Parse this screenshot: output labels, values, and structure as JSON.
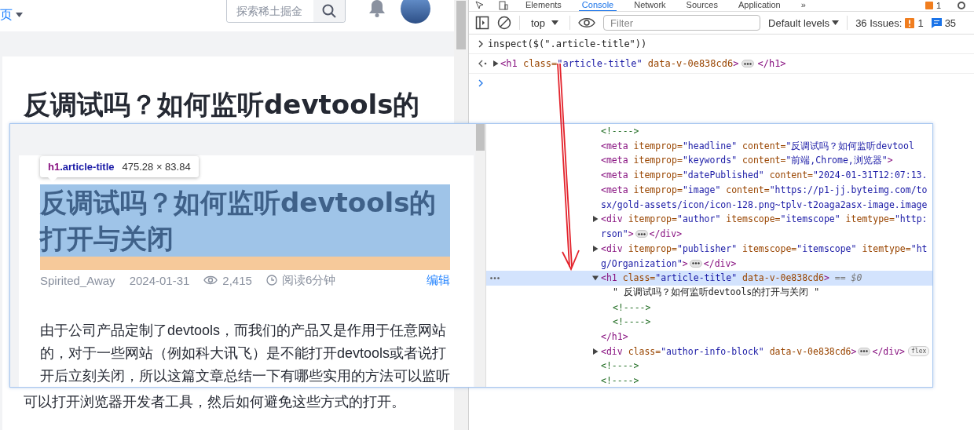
{
  "page": {
    "nav": {
      "menu_label": "页",
      "search": {
        "placeholder": "探索稀土掘金"
      }
    },
    "article": {
      "title": "反调试吗？如何监听devtools的",
      "paragraph_tail": "可以打开浏览器开发者工具，然后如何避免这些方式的打开。"
    }
  },
  "devtools": {
    "tabs": [
      {
        "label": "Elements",
        "selected": false
      },
      {
        "label": "Console",
        "selected": true
      },
      {
        "label": "Network",
        "selected": false
      },
      {
        "label": "Sources",
        "selected": false
      },
      {
        "label": "Application",
        "selected": false
      }
    ],
    "more_tabs": "»",
    "issues_badge": "1",
    "toolbar": {
      "context": "top",
      "filter_placeholder": "Filter",
      "levels": "Default levels",
      "issues_label": "36 Issues:",
      "warning_count": "1",
      "info_count": "35"
    },
    "console": [
      {
        "kind": "input",
        "text": "inspect($(\".article-title\"))"
      },
      {
        "kind": "result",
        "expanded": false,
        "segments": [
          {
            "kind": "tag",
            "text": "<h1"
          },
          {
            "kind": "attr",
            "text": " class="
          },
          {
            "kind": "value",
            "text": "\"article-title\""
          },
          {
            "kind": "attr",
            "text": " data-v-0e838cd6"
          },
          {
            "kind": "tag",
            "text": ">"
          },
          {
            "kind": "ellipsis"
          },
          {
            "kind": "tag",
            "text": "</h1>"
          }
        ]
      },
      {
        "kind": "prompt"
      }
    ]
  },
  "zoom_overlay": {
    "preview": {
      "tooltip": {
        "tag": "h1",
        "selector": ".article-title",
        "size": "475.28 × 83.84"
      },
      "title": "反调试吗？如何监听devtools的打开与关闭",
      "meta": {
        "author": "Spirited_Away",
        "date": "2024-01-31",
        "views": "2,415",
        "read_time": "阅读6分钟",
        "edit_link": "编辑"
      },
      "paragraph": "由于公司产品定制了devtools，而我们的产品又是作用于任意网站的，对于一些网站（例如科大讯飞）是不能打开devtools或者说打开后立刻关闭，所以这篇文章总结一下有哪些实用的方法可以监听"
    },
    "elements_tree": [
      {
        "kind": "comment",
        "text": "<!---->"
      },
      {
        "kind": "element",
        "lines": [
          [
            {
              "kind": "tag",
              "text": "<meta"
            },
            {
              "kind": "attr",
              "text": " itemprop="
            },
            {
              "kind": "value",
              "text": "\"headline\""
            },
            {
              "kind": "attr",
              "text": " content="
            },
            {
              "kind": "value",
              "text": "\"反调试吗？如何监听devtool"
            }
          ]
        ]
      },
      {
        "kind": "element",
        "lines": [
          [
            {
              "kind": "tag",
              "text": "<meta"
            },
            {
              "kind": "attr",
              "text": " itemprop="
            },
            {
              "kind": "value",
              "text": "\"keywords\""
            },
            {
              "kind": "attr",
              "text": " content="
            },
            {
              "kind": "value",
              "text": "\"前端,Chrome,浏览器\""
            },
            {
              "kind": "tag",
              "text": ">"
            }
          ]
        ]
      },
      {
        "kind": "element",
        "lines": [
          [
            {
              "kind": "tag",
              "text": "<meta"
            },
            {
              "kind": "attr",
              "text": " itemprop="
            },
            {
              "kind": "value",
              "text": "\"datePublished\""
            },
            {
              "kind": "attr",
              "text": " content="
            },
            {
              "kind": "value",
              "text": "\"2024-01-31T12:07:13."
            }
          ]
        ]
      },
      {
        "kind": "element",
        "lines": [
          [
            {
              "kind": "tag",
              "text": "<meta"
            },
            {
              "kind": "attr",
              "text": " itemprop="
            },
            {
              "kind": "value",
              "text": "\"image\""
            },
            {
              "kind": "attr",
              "text": " content="
            },
            {
              "kind": "value",
              "text": "\"https://p1-jj.byteimg.com/to"
            }
          ],
          [
            {
              "kind": "value",
              "text": "sx/gold-assets/icon/icon-128.png~tplv-t2oaga2asx-image.image"
            }
          ]
        ]
      },
      {
        "kind": "element",
        "expanded": false,
        "lines": [
          [
            {
              "kind": "tag",
              "text": "<div"
            },
            {
              "kind": "attr",
              "text": " itemprop="
            },
            {
              "kind": "value",
              "text": "\"author\""
            },
            {
              "kind": "attr",
              "text": " itemscope="
            },
            {
              "kind": "value",
              "text": "\"itemscope\""
            },
            {
              "kind": "attr",
              "text": " itemtype="
            },
            {
              "kind": "value",
              "text": "\"http:"
            }
          ],
          [
            {
              "kind": "value",
              "text": "rson\""
            },
            {
              "kind": "tag",
              "text": ">"
            },
            {
              "kind": "ellipsis"
            },
            {
              "kind": "tag",
              "text": "</div>"
            }
          ]
        ]
      },
      {
        "kind": "element",
        "expanded": false,
        "lines": [
          [
            {
              "kind": "tag",
              "text": "<div"
            },
            {
              "kind": "attr",
              "text": " itemprop="
            },
            {
              "kind": "value",
              "text": "\"publisher\""
            },
            {
              "kind": "attr",
              "text": " itemscope="
            },
            {
              "kind": "value",
              "text": "\"itemscope\""
            },
            {
              "kind": "attr",
              "text": " itemtype="
            },
            {
              "kind": "value",
              "text": "\"ht"
            }
          ],
          [
            {
              "kind": "value",
              "text": "g/Organization\""
            },
            {
              "kind": "tag",
              "text": ">"
            },
            {
              "kind": "ellipsis"
            },
            {
              "kind": "tag",
              "text": "</div>"
            }
          ]
        ]
      },
      {
        "kind": "element",
        "expanded": true,
        "selected": true,
        "marker": "== $0",
        "lines": [
          [
            {
              "kind": "tag",
              "text": "<h1"
            },
            {
              "kind": "attr",
              "text": " class="
            },
            {
              "kind": "value",
              "text": "\"article-title\""
            },
            {
              "kind": "attr",
              "text": " data-v-0e838cd6"
            },
            {
              "kind": "tag",
              "text": ">"
            }
          ]
        ],
        "children": [
          {
            "kind": "text",
            "text": "\" 反调试吗？如何监听devtools的打开与关闭 \""
          },
          {
            "kind": "comment",
            "text": "<!---->"
          },
          {
            "kind": "comment",
            "text": "<!---->"
          }
        ],
        "closing": "</h1>"
      },
      {
        "kind": "element",
        "expanded": false,
        "lines": [
          [
            {
              "kind": "tag",
              "text": "<div"
            },
            {
              "kind": "attr",
              "text": " class="
            },
            {
              "kind": "value",
              "text": "\"author-info-block\""
            },
            {
              "kind": "attr",
              "text": " data-v-0e838cd6"
            },
            {
              "kind": "tag",
              "text": ">"
            },
            {
              "kind": "ellipsis"
            },
            {
              "kind": "tag",
              "text": "</div>"
            },
            {
              "kind": "badge",
              "text": "flex"
            }
          ]
        ]
      },
      {
        "kind": "comment",
        "text": "<!---->"
      },
      {
        "kind": "comment",
        "text": "<!---->"
      }
    ]
  }
}
